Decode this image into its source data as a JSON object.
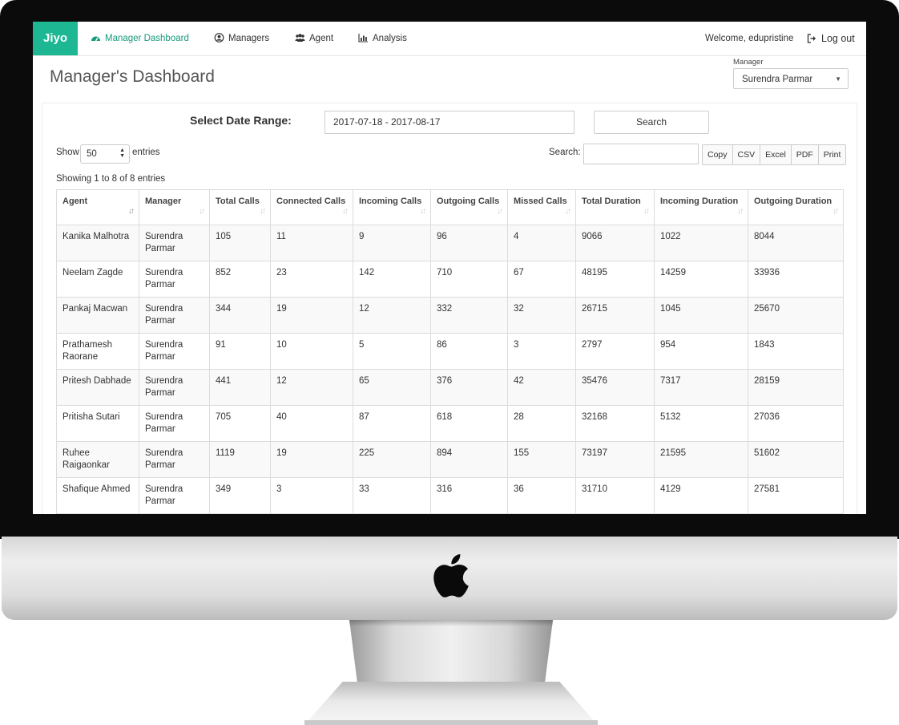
{
  "navbar": {
    "brand": "Jiyo",
    "items": [
      {
        "label": "Manager Dashboard",
        "icon": "dashboard-icon",
        "active": true
      },
      {
        "label": "Managers",
        "icon": "user-circle-icon",
        "active": false
      },
      {
        "label": "Agent",
        "icon": "users-icon",
        "active": false
      },
      {
        "label": "Analysis",
        "icon": "bar-chart-icon",
        "active": false
      }
    ],
    "welcome": "Welcome, edupristine",
    "logout": "Log out"
  },
  "page": {
    "title": "Manager's Dashboard",
    "manager_label": "Manager",
    "manager_selected": "Surendra Parmar"
  },
  "filters": {
    "date_label": "Select Date Range:",
    "date_range": "2017-07-18 - 2017-08-17",
    "search_button": "Search"
  },
  "table_controls": {
    "show_label": "Show",
    "page_size": "50",
    "entries_label": "entries",
    "search_label": "Search:",
    "search_value": "",
    "export_buttons": [
      "Copy",
      "CSV",
      "Excel",
      "PDF",
      "Print"
    ],
    "info": "Showing 1 to 8 of 8 entries"
  },
  "table": {
    "columns": [
      "Agent",
      "Manager",
      "Total Calls",
      "Connected Calls",
      "Incoming Calls",
      "Outgoing Calls",
      "Missed Calls",
      "Total Duration",
      "Incoming Duration",
      "Outgoing Duration"
    ],
    "rows": [
      [
        "Kanika Malhotra",
        "Surendra Parmar",
        "105",
        "11",
        "9",
        "96",
        "4",
        "9066",
        "1022",
        "8044"
      ],
      [
        "Neelam Zagde",
        "Surendra Parmar",
        "852",
        "23",
        "142",
        "710",
        "67",
        "48195",
        "14259",
        "33936"
      ],
      [
        "Pankaj Macwan",
        "Surendra Parmar",
        "344",
        "19",
        "12",
        "332",
        "32",
        "26715",
        "1045",
        "25670"
      ],
      [
        "Prathamesh Raorane",
        "Surendra Parmar",
        "91",
        "10",
        "5",
        "86",
        "3",
        "2797",
        "954",
        "1843"
      ],
      [
        "Pritesh Dabhade",
        "Surendra Parmar",
        "441",
        "12",
        "65",
        "376",
        "42",
        "35476",
        "7317",
        "28159"
      ],
      [
        "Pritisha Sutari",
        "Surendra Parmar",
        "705",
        "40",
        "87",
        "618",
        "28",
        "32168",
        "5132",
        "27036"
      ],
      [
        "Ruhee Raigaonkar",
        "Surendra Parmar",
        "1119",
        "19",
        "225",
        "894",
        "155",
        "73197",
        "21595",
        "51602"
      ],
      [
        "Shafique Ahmed",
        "Surendra Parmar",
        "349",
        "3",
        "33",
        "316",
        "36",
        "31710",
        "4129",
        "27581"
      ]
    ]
  },
  "colors": {
    "brand": "#1db893",
    "active_nav": "#1a9b7e"
  }
}
